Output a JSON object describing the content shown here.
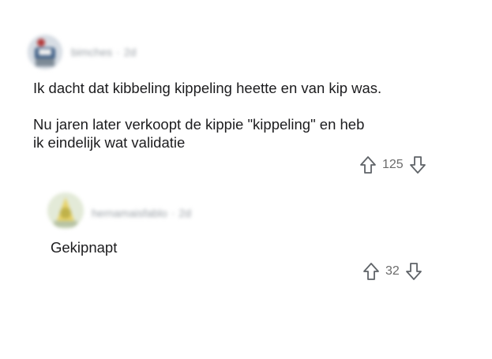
{
  "comments": [
    {
      "username": "bimches",
      "age": "2d",
      "paragraphs": [
        "Ik dacht dat kibbeling kippeling heette en van kip was.",
        "Nu jaren later verkoopt de kippie \"kippeling\" en heb ik eindelijk wat validatie"
      ],
      "score": "125",
      "avatar_icon": "blurred-avatar-icon"
    },
    {
      "username": "hernamaisfablo",
      "age": "2d",
      "paragraphs": [
        "Gekipnapt"
      ],
      "score": "32",
      "avatar_icon": "blurred-avatar-icon"
    }
  ],
  "icons": {
    "upvote": "arrow-up-outline-icon",
    "downvote": "arrow-down-outline-icon"
  },
  "colors": {
    "text": "#1c1c1e",
    "muted": "#6b6b6b",
    "icon": "#5f6368"
  }
}
